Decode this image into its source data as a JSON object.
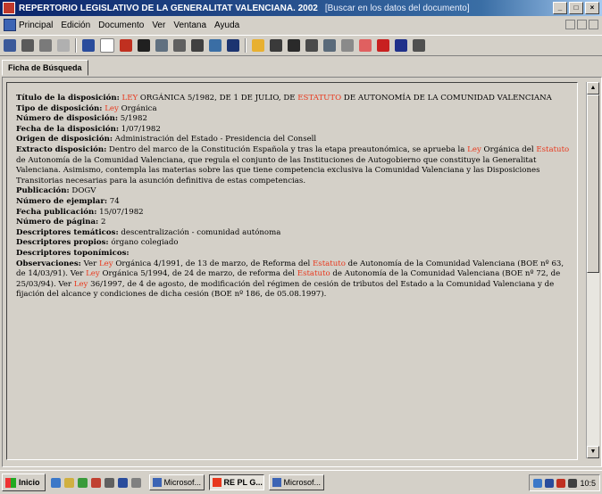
{
  "window": {
    "title": "REPERTORIO LEGISLATIVO DE LA GENERALITAT VALENCIANA. 2002",
    "subtitle": "[Buscar en los datos del documento]",
    "controls": [
      "_",
      "□",
      "×"
    ]
  },
  "menu": {
    "items": [
      "Principal",
      "Edición",
      "Documento",
      "Ver",
      "Ventana",
      "Ayuda"
    ]
  },
  "toolbar": {
    "icons": [
      "folder-icon",
      "back-icon",
      "forward-icon",
      "grid-icon",
      "globe-icon",
      "page-icon",
      "pen-icon",
      "binoculars-icon",
      "index-icon",
      "save-icon",
      "tools-icon",
      "undo-icon",
      "print-icon",
      "bookmark-icon",
      "copy-icon",
      "export-icon",
      "options-icon",
      "search-icon",
      "highlight-icon",
      "red-square-icon",
      "disc-icon",
      "book-icon",
      "exit-icon"
    ]
  },
  "tab": {
    "label": "Ficha de Búsqueda"
  },
  "record": {
    "titulo_label": "Título de la disposición:",
    "titulo_pre_hl": "LEY",
    "titulo_mid": " ORGÁNICA 5/1982, DE 1 DE JULIO, DE ",
    "titulo_hl2": "ESTATUTO",
    "titulo_end": " DE AUTONOMÍA DE LA COMUNIDAD VALENCIANA",
    "tipo_label": "Tipo de disposición:",
    "tipo_hl": "Ley",
    "tipo_value": " Orgánica",
    "numero_label": "Número de disposición:",
    "numero_value": " 5/1982",
    "fecha_label": "Fecha de la disposición:",
    "fecha_value": " 1/07/1982",
    "origen_label": "Origen de disposición:",
    "origen_value": " Administración del Estado - Presidencia del Consell",
    "extracto_label": "Extracto disposición:",
    "extracto_1": " Dentro del marco de la Constitución Española y tras la etapa preautonómica, se aprueba la ",
    "extracto_hl1": "Ley",
    "extracto_2": " Orgánica del ",
    "extracto_hl2": "Estatuto",
    "extracto_3": " de Autonomía de la Comunidad Valenciana, que regula el conjunto de las Instituciones de Autogobierno que constituye la Generalitat Valenciana. Asimismo, contempla las materias sobre las que tiene competencia exclusiva la Comunidad Valenciana y las Disposiciones Transitorias necesarias para la asunción definitiva de estas competencias.",
    "publicacion_label": "Publicación:",
    "publicacion_value": " DOGV",
    "num_ejemplar_label": "Número de ejemplar:",
    "num_ejemplar_value": " 74",
    "fecha_pub_label": "Fecha publicación:",
    "fecha_pub_value": " 15/07/1982",
    "num_pagina_label": "Número de página:",
    "num_pagina_value": " 2",
    "desc_tem_label": "Descriptores temáticos:",
    "desc_tem_value": " descentralización - comunidad autónoma",
    "desc_prop_label": "Descriptores propios:",
    "desc_prop_value": " órgano colegiado",
    "desc_topo_label": "Descriptores toponímicos:",
    "desc_topo_value": "",
    "obs_label": "Observaciones:",
    "obs_1": " Ver ",
    "obs_hl1": "Ley",
    "obs_2": " Orgánica 4/1991, de 13 de marzo, de Reforma del ",
    "obs_hl2": "Estatuto",
    "obs_3": " de Autonomía de la Comunidad Valenciana (BOE nº 63, de 14/03/91). Ver ",
    "obs_hl3": "Ley",
    "obs_4": " Orgánica 5/1994, de 24 de marzo, de reforma del ",
    "obs_hl4": "Estatuto",
    "obs_5": " de Autonomía de la Comunidad Valenciana (BOE nº 72, de 25/03/94). Ver ",
    "obs_hl5": "Ley",
    "obs_6": " 36/1997, de 4 de agosto, de modificación del régimen de cesión de tributos del Estado a la Comunidad Valenciana y de fijación del alcance y condiciones de dicha cesión (BOE nº 186, de 05.08.1997)."
  },
  "taskbar": {
    "start": "Inicio",
    "buttons": [
      "Microsof...",
      "RE PL G...",
      "Microsof..."
    ],
    "clock": "10:5"
  },
  "colors": {
    "highlight": "#e8381d",
    "titlebar": "#0a246a",
    "face": "#d4d0c8"
  }
}
